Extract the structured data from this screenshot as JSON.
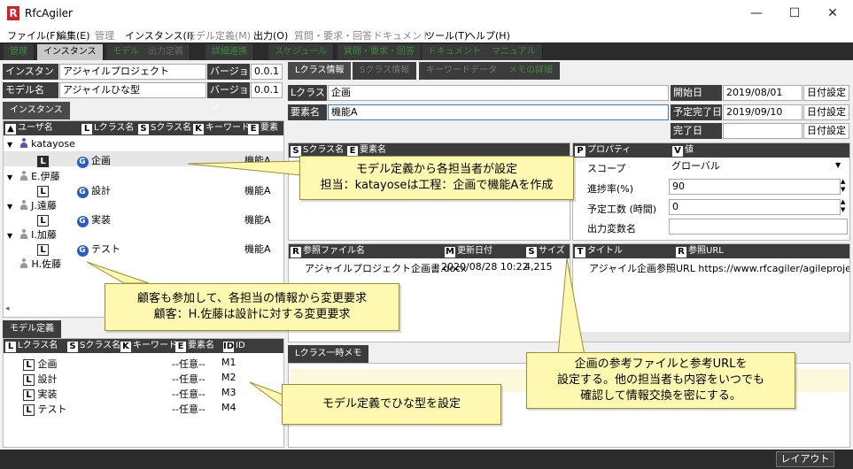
{
  "window": {
    "title": "RfcAgiler",
    "app_icon": "R",
    "minimize": "—",
    "maximize": "☐",
    "close": "✕"
  },
  "menu": [
    "ファイル(F)",
    "編集(E)",
    "管理",
    "インスタンス(I)",
    "モデル定義(M)",
    "出力(O)",
    "質問・要求・回答",
    "ドキュメント",
    "ツール(T)",
    "ヘルプ(H)"
  ],
  "toolbar_tabs": [
    "管理",
    "インスタンス",
    "モデル",
    "出力定義",
    "詳細連携",
    "スケジュール",
    "質問・要求・回答",
    "ドキュメント",
    "マニュアル"
  ],
  "instance": {
    "name_label": "インスタンス名",
    "name_value": "アジャイルプロジェクト",
    "version_label": "バージョン",
    "version_value": "0.0.1"
  },
  "model": {
    "name_label": "モデル名",
    "name_value": "アジャイルひな型",
    "version_label": "バージョン",
    "version_value": "0.0.1"
  },
  "instance_tab": "インスタンス",
  "tree_headers": {
    "user": "ユーザ名",
    "lclass": "Lクラス名",
    "sclass": "Sクラス名",
    "keyword": "キーワード",
    "element": "要素名"
  },
  "tree": [
    {
      "user": "katayose",
      "color": "#6a4fb3",
      "children": [
        {
          "lclass": "企画",
          "element": "機能A",
          "selected": true
        }
      ]
    },
    {
      "user": "E.伊藤",
      "color": "#999999",
      "children": [
        {
          "lclass": "設計",
          "element": "機能A"
        }
      ]
    },
    {
      "user": "J.遠藤",
      "color": "#999999",
      "children": [
        {
          "lclass": "実装",
          "element": "機能A"
        }
      ]
    },
    {
      "user": "I.加藤",
      "color": "#999999",
      "children": [
        {
          "lclass": "テスト",
          "element": "機能A"
        }
      ]
    },
    {
      "user": "H.佐藤",
      "color": "#999999",
      "children": []
    }
  ],
  "model_tab": "モデル定義",
  "model_headers": {
    "lclass": "Lクラス名",
    "sclass": "Sクラス名",
    "keyword": "キーワード",
    "element": "要素名",
    "id": "ID"
  },
  "model_rows": [
    {
      "lclass": "企画",
      "element": "--任意--",
      "id": "M1"
    },
    {
      "lclass": "設計",
      "element": "--任意--",
      "id": "M2"
    },
    {
      "lclass": "実装",
      "element": "--任意--",
      "id": "M3"
    },
    {
      "lclass": "テスト",
      "element": "--任意--",
      "id": "M4"
    }
  ],
  "right_tabs": [
    "Lクラス情報",
    "Sクラス情報",
    "キーワードデータ",
    "メモの詳細"
  ],
  "lclass": {
    "label": "Lクラス名",
    "value": "企画",
    "element_label": "要素名",
    "element_value": "機能A"
  },
  "dates": {
    "start_label": "開始日",
    "start_value": "2019/08/01",
    "due_label": "予定完了日",
    "due_value": "2019/09/10",
    "done_label": "完了日",
    "done_value": "",
    "set_button": "日付設定"
  },
  "sclass_headers": {
    "sclass": "Sクラス名",
    "element": "要素名"
  },
  "props_headers": {
    "property": "プロパティ",
    "value": "値"
  },
  "props": [
    {
      "name": "スコープ",
      "value": "グローバル",
      "kind": "select"
    },
    {
      "name": "進捗率(%)",
      "value": "90",
      "kind": "spin"
    },
    {
      "name": "予定工数 (時間)",
      "value": "0",
      "kind": "spin"
    },
    {
      "name": "出力変数名",
      "value": "",
      "kind": "text"
    }
  ],
  "files_headers": {
    "file": "参照ファイル名",
    "date": "更新日付",
    "size": "サイズ"
  },
  "files": [
    {
      "name": "アジャイルプロジェクト企画書.docx",
      "date": "2020/08/28 10:22",
      "size": "4,215"
    }
  ],
  "urls_headers": {
    "title": "タイトル",
    "url": "参照URL"
  },
  "urls": [
    {
      "title": "アジャイル企画参照URL",
      "url": "https://www.rfcagiler/agileproject.htm"
    }
  ],
  "memo_tab": "Lクラス一時メモ",
  "status_button": "レイアウト",
  "callouts": {
    "c1": [
      "モデル定義から各担当者が設定",
      "担当：katayoseは工程：企画で機能Aを作成"
    ],
    "c2": [
      "顧客も参加して、各担当の情報から変更要求",
      "顧客：H.佐藤は設計に対する変更要求"
    ],
    "c3": [
      "モデル定義でひな型を設定"
    ],
    "c4": [
      "企画の参考ファイルと参考URLを",
      "設定する。他の担当者も内容をいつでも",
      "確認して情報交換を密にする。"
    ]
  }
}
